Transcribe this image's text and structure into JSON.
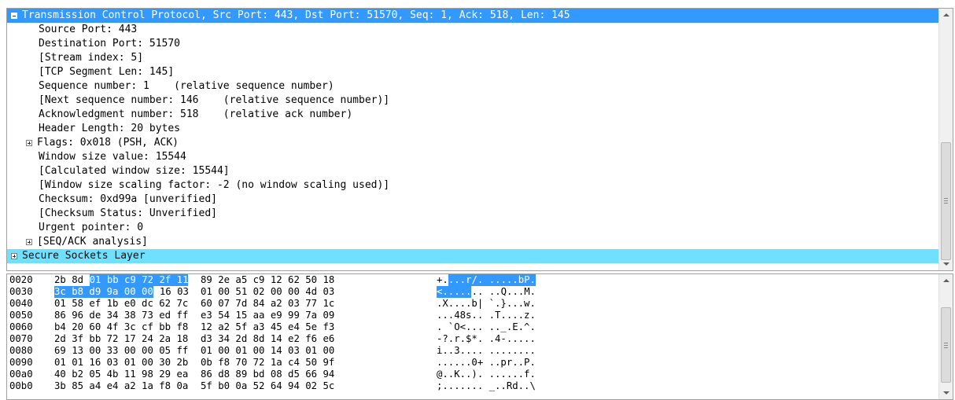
{
  "details": {
    "rows": [
      {
        "text": "Transmission Control Protocol, Src Port: 443, Dst Port: 51570, Seq: 1, Ack: 518, Len: 145",
        "indent": 0,
        "expander": "minus",
        "style": "selected"
      },
      {
        "text": "Source Port: 443",
        "indent": 1,
        "expander": "",
        "style": ""
      },
      {
        "text": "Destination Port: 51570",
        "indent": 1,
        "expander": "",
        "style": ""
      },
      {
        "text": "[Stream index: 5]",
        "indent": 1,
        "expander": "",
        "style": ""
      },
      {
        "text": "[TCP Segment Len: 145]",
        "indent": 1,
        "expander": "",
        "style": ""
      },
      {
        "text": "Sequence number: 1    (relative sequence number)",
        "indent": 1,
        "expander": "",
        "style": ""
      },
      {
        "text": "[Next sequence number: 146    (relative sequence number)]",
        "indent": 1,
        "expander": "",
        "style": ""
      },
      {
        "text": "Acknowledgment number: 518    (relative ack number)",
        "indent": 1,
        "expander": "",
        "style": ""
      },
      {
        "text": "Header Length: 20 bytes",
        "indent": 1,
        "expander": "",
        "style": ""
      },
      {
        "text": "Flags: 0x018 (PSH, ACK)",
        "indent": 1,
        "expander": "plus",
        "style": ""
      },
      {
        "text": "Window size value: 15544",
        "indent": 1,
        "expander": "",
        "style": ""
      },
      {
        "text": "[Calculated window size: 15544]",
        "indent": 1,
        "expander": "",
        "style": ""
      },
      {
        "text": "[Window size scaling factor: -2 (no window scaling used)]",
        "indent": 1,
        "expander": "",
        "style": ""
      },
      {
        "text": "Checksum: 0xd99a [unverified]",
        "indent": 1,
        "expander": "",
        "style": ""
      },
      {
        "text": "[Checksum Status: Unverified]",
        "indent": 1,
        "expander": "",
        "style": ""
      },
      {
        "text": "Urgent pointer: 0",
        "indent": 1,
        "expander": "",
        "style": ""
      },
      {
        "text": "[SEQ/ACK analysis]",
        "indent": 1,
        "expander": "plus",
        "style": ""
      },
      {
        "text": "Secure Sockets Layer",
        "indent": 0,
        "expander": "plus",
        "style": "ssl"
      }
    ]
  },
  "bytes": {
    "rows": [
      {
        "offset": "0020",
        "hex_a": "2b 8d",
        "hex_b": "01 bb c9 72 2f 11",
        "hex_c": "",
        "hex_d": "89 2e a5 c9 12 62 50 18",
        "ascii_a": "+.",
        "ascii_b": "...r/. .....bP.",
        "ascii_c": ""
      },
      {
        "offset": "0030",
        "hex_a": "",
        "hex_b": "3c b8 d9 9a 00 00",
        "hex_c": "16 03",
        "hex_d": "01 00 51 02 00 00 4d 03",
        "ascii_a": "",
        "ascii_b": "<.....",
        "ascii_c": ".. ..Q...M."
      },
      {
        "offset": "0040",
        "hex_a": "01 58 ef 1b e0 dc 62 7c",
        "hex_b": "",
        "hex_c": "",
        "hex_d": "60 07 7d 84 a2 03 77 1c",
        "ascii_a": ".X....b| `.}...w.",
        "ascii_b": "",
        "ascii_c": ""
      },
      {
        "offset": "0050",
        "hex_a": "86 96 de 34 38 73 ed ff",
        "hex_b": "",
        "hex_c": "",
        "hex_d": "e3 54 15 aa e9 99 7a 09",
        "ascii_a": "...48s.. .T....z.",
        "ascii_b": "",
        "ascii_c": ""
      },
      {
        "offset": "0060",
        "hex_a": "b4 20 60 4f 3c cf bb f8",
        "hex_b": "",
        "hex_c": "",
        "hex_d": "12 a2 5f a3 45 e4 5e f3",
        "ascii_a": ". `O<... .._.E.^.",
        "ascii_b": "",
        "ascii_c": ""
      },
      {
        "offset": "0070",
        "hex_a": "2d 3f bb 72 17 24 2a 18",
        "hex_b": "",
        "hex_c": "",
        "hex_d": "d3 34 2d 8d 14 e2 f6 e6",
        "ascii_a": "-?.r.$*. .4-.....",
        "ascii_b": "",
        "ascii_c": ""
      },
      {
        "offset": "0080",
        "hex_a": "69 13 00 33 00 00 05 ff",
        "hex_b": "",
        "hex_c": "",
        "hex_d": "01 00 01 00 14 03 01 00",
        "ascii_a": "i..3.... ........",
        "ascii_b": "",
        "ascii_c": ""
      },
      {
        "offset": "0090",
        "hex_a": "01 01 16 03 01 00 30 2b",
        "hex_b": "",
        "hex_c": "",
        "hex_d": "0b f8 70 72 1a c4 50 9f",
        "ascii_a": "......0+ ..pr..P.",
        "ascii_b": "",
        "ascii_c": ""
      },
      {
        "offset": "00a0",
        "hex_a": "40 b2 05 4b 11 98 29 ea",
        "hex_b": "",
        "hex_c": "",
        "hex_d": "86 d8 89 bd 08 d5 66 94",
        "ascii_a": "@..K..). ......f.",
        "ascii_b": "",
        "ascii_c": ""
      },
      {
        "offset": "00b0",
        "hex_a": "3b 85 a4 e4 a2 1a f8 0a",
        "hex_b": "",
        "hex_c": "",
        "hex_d": "5f b0 0a 52 64 94 02 5c",
        "ascii_a": ";....... _..Rd..\\",
        "ascii_b": "",
        "ascii_c": ""
      }
    ]
  },
  "colors": {
    "selection": "#3399ff",
    "ssl_row": "#70e0ff"
  }
}
